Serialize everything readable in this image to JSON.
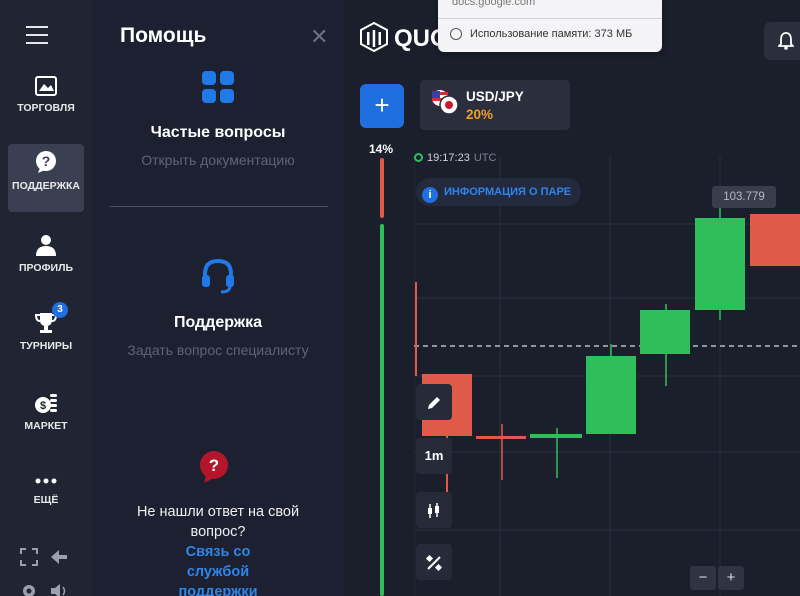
{
  "nav": {
    "items": [
      {
        "label": "ТОРГОВЛЯ",
        "icon": "chart-image-icon"
      },
      {
        "label": "ПОДДЕРЖКА",
        "icon": "question-bubble-icon"
      },
      {
        "label": "ПРОФИЛЬ",
        "icon": "user-icon"
      },
      {
        "label": "ТУРНИРЫ",
        "icon": "trophy-icon",
        "badge": "3"
      },
      {
        "label": "МАРКЕТ",
        "icon": "coins-icon"
      },
      {
        "label": "ЕЩЁ",
        "icon": "more-dots-icon"
      }
    ]
  },
  "help": {
    "title": "Помощь",
    "faq_title": "Частые вопросы",
    "faq_sub": "Открыть документацию",
    "support_title": "Поддержка",
    "support_sub": "Задать вопрос специалисту",
    "notfound": "Не нашли ответ на свой вопрос?",
    "contact": "Связь со службой поддержки"
  },
  "trade": {
    "logo": "QUO",
    "pair_name": "USD/JPY",
    "pair_pct": "20%",
    "sentiment_pct": "14%",
    "time": "19:17:23",
    "tz": "UTC",
    "info_label": "ИНФОРМАЦИЯ О ПАРЕ",
    "price": "103.779",
    "timeframe": "1m",
    "zoom_minus": "−",
    "zoom_plus": "+"
  },
  "tooltip": {
    "domain": "docs.google.com",
    "memory": "Использование памяти: 373 МБ"
  },
  "colors": {
    "accent": "#1f6fe0",
    "up": "#2fbf5a",
    "down": "#e05a4a",
    "percent": "#f39c2a"
  }
}
